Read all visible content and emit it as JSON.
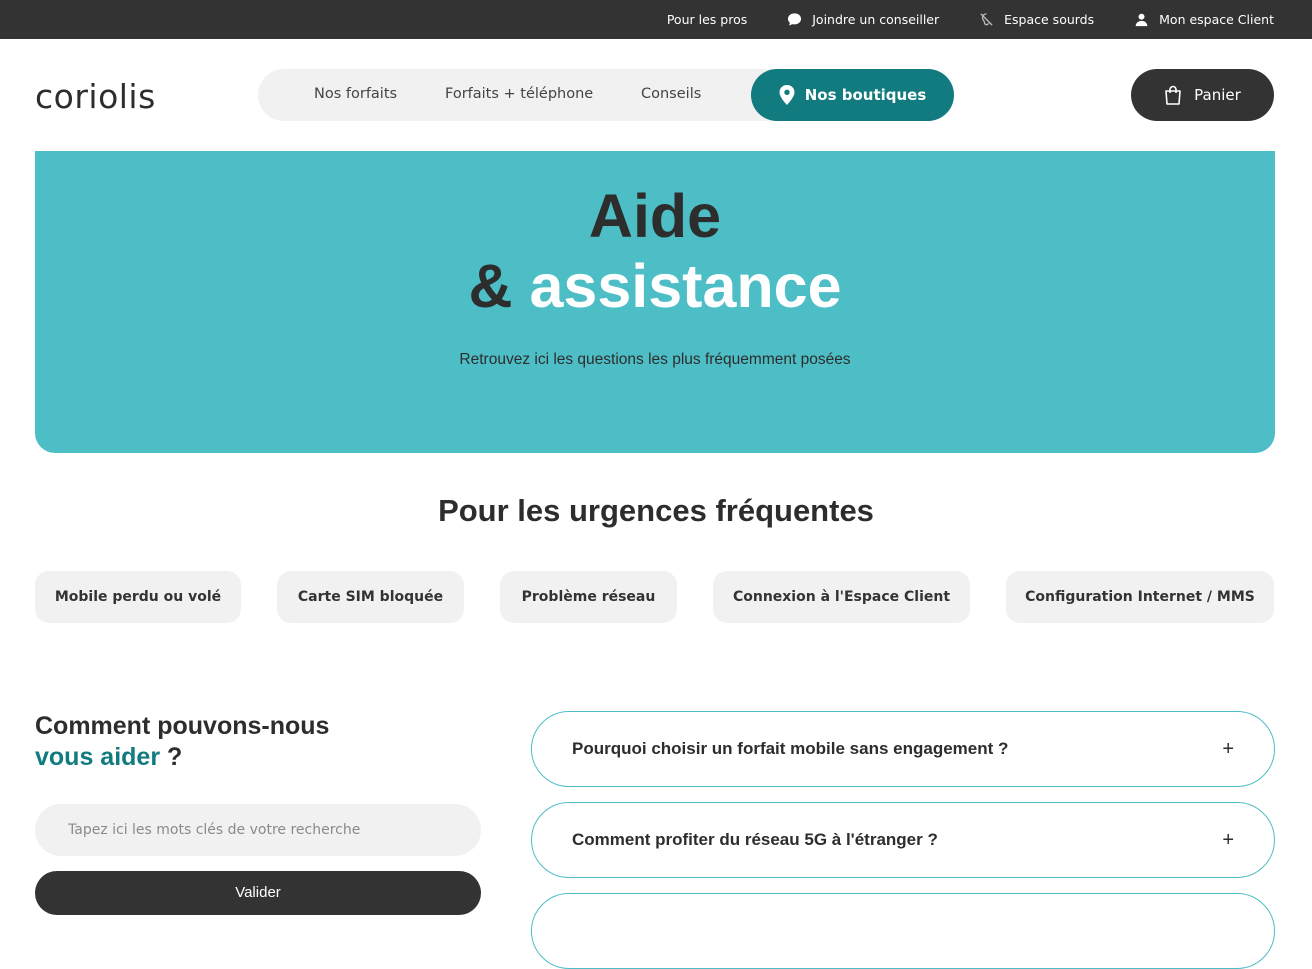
{
  "topbar": {
    "pros": "Pour les pros",
    "advisor": "Joindre un conseiller",
    "deaf": "Espace sourds",
    "client": "Mon espace Client"
  },
  "header": {
    "logo": "coriolis",
    "nav": [
      "Nos forfaits",
      "Forfaits + téléphone",
      "Conseils"
    ],
    "shops": "Nos boutiques",
    "cart": "Panier"
  },
  "hero": {
    "title_line1": "Aide",
    "title_amp": "&",
    "title_line2": "assistance",
    "subtitle": "Retrouvez ici les questions les plus fréquemment posées"
  },
  "urgences": {
    "title": "Pour les urgences fréquentes",
    "chips": [
      "Mobile perdu ou volé",
      "Carte SIM bloquée",
      "Problème réseau",
      "Connexion à l'Espace Client",
      "Configuration Internet / MMS"
    ]
  },
  "help": {
    "title_part1": "Comment pouvons-nous",
    "title_accent": "vous aider",
    "title_end": "?",
    "search_placeholder": "Tapez ici les mots clés de votre recherche",
    "validate": "Valider"
  },
  "faq": [
    {
      "question": "Pourquoi choisir un forfait mobile sans engagement ?",
      "icon": "+"
    },
    {
      "question": "Comment profiter du réseau 5G à l'étranger ?",
      "icon": "+"
    },
    {
      "question": "",
      "icon": ""
    }
  ],
  "colors": {
    "teal": "#4dbdc6",
    "dark_teal": "#117b80",
    "dark": "#333333"
  }
}
